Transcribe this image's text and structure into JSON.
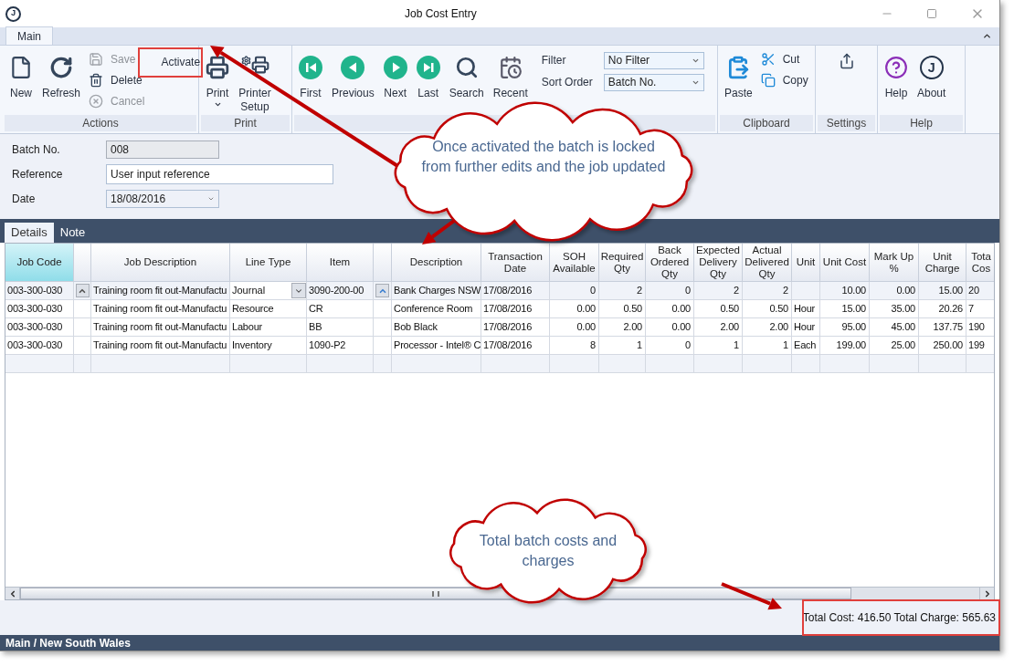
{
  "window": {
    "title": "Job Cost Entry",
    "icon_letter": "J"
  },
  "ribbon": {
    "tabs": [
      {
        "label": "Main",
        "selected": true
      }
    ],
    "groups": [
      {
        "label": "Actions",
        "buttons": [
          {
            "kind": "large",
            "label": "New",
            "disabled": false
          },
          {
            "kind": "large",
            "label": "Refresh",
            "disabled": false
          },
          {
            "kind": "small",
            "label": "Save",
            "disabled": true
          },
          {
            "kind": "small",
            "label": "Delete",
            "disabled": false
          },
          {
            "kind": "small",
            "label": "Cancel",
            "disabled": true
          },
          {
            "kind": "plain",
            "label": "Activate",
            "disabled": false
          }
        ]
      },
      {
        "label": "Print",
        "buttons": [
          {
            "kind": "large",
            "label": "Print",
            "dropdown": true,
            "disabled": false
          },
          {
            "kind": "large",
            "label": "Printer Setup",
            "disabled": false
          }
        ]
      },
      {
        "buttons": [
          {
            "kind": "large",
            "label": "First",
            "disabled": false
          },
          {
            "kind": "large",
            "label": "Previous",
            "disabled": false
          },
          {
            "kind": "large",
            "label": "Next",
            "disabled": false
          },
          {
            "kind": "large",
            "label": "Last",
            "disabled": false
          },
          {
            "kind": "large",
            "label": "Search",
            "disabled": false
          },
          {
            "kind": "large",
            "label": "Recent",
            "disabled": false
          }
        ],
        "fields": [
          {
            "label": "Filter",
            "value": "No Filter"
          },
          {
            "label": "Sort Order",
            "value": "Batch No."
          }
        ]
      },
      {
        "label": "Clipboard",
        "buttons": [
          {
            "kind": "large",
            "label": "Paste",
            "disabled": false
          },
          {
            "kind": "small",
            "label": "Cut",
            "disabled": false
          },
          {
            "kind": "small",
            "label": "Copy",
            "disabled": false
          }
        ]
      },
      {
        "label": "Settings",
        "buttons": [
          {
            "kind": "icon",
            "disabled": false
          }
        ]
      },
      {
        "label": "Help",
        "buttons": [
          {
            "kind": "large",
            "label": "Help",
            "disabled": false
          },
          {
            "kind": "large",
            "icon_letter": "J",
            "label": "About",
            "disabled": false
          }
        ]
      }
    ]
  },
  "form": {
    "fields": [
      {
        "kind": "readonly",
        "label": "Batch No.",
        "value": "008"
      },
      {
        "kind": "text",
        "label": "Reference",
        "value": "User input reference"
      },
      {
        "kind": "date",
        "label": "Date",
        "value": "18/08/2016"
      }
    ]
  },
  "detail_tabs": [
    {
      "label": "Details",
      "selected": true
    },
    {
      "label": "Note",
      "selected": false
    }
  ],
  "grid": {
    "columns": [
      {
        "kind": "text",
        "label": "Job Code",
        "selected": true
      },
      {
        "kind": "lookup",
        "selected": false
      },
      {
        "kind": "text",
        "label": "Job Description",
        "selected": false
      },
      {
        "kind": "choice",
        "label": "Line Type",
        "selected": false
      },
      {
        "kind": "text",
        "label": "Item",
        "selected": false
      },
      {
        "kind": "lookup",
        "selected": false
      },
      {
        "kind": "text",
        "label": "Description",
        "selected": false
      },
      {
        "kind": "text",
        "label": "Transaction Date",
        "selected": false
      },
      {
        "kind": "number",
        "label": "SOH Available",
        "selected": false
      },
      {
        "kind": "number",
        "label": "Required Qty",
        "selected": false
      },
      {
        "kind": "number",
        "label": "Back Ordered Qty",
        "selected": false
      },
      {
        "kind": "number",
        "label": "Expected Delivery Qty",
        "selected": false
      },
      {
        "kind": "number",
        "label": "Actual Delivered Qty",
        "selected": false
      },
      {
        "kind": "text",
        "label": "Unit",
        "selected": false
      },
      {
        "kind": "number",
        "label": "Unit Cost",
        "selected": false
      },
      {
        "kind": "number",
        "label": "Mark Up %",
        "selected": false
      },
      {
        "kind": "number",
        "label": "Unit Charge",
        "selected": false
      },
      {
        "kind": "text",
        "label": "Tota Cos",
        "selected": false
      }
    ],
    "rows": [
      {
        "current": true,
        "cells": [
          "003-300-030",
          "",
          "Training room fit out-Manufactu",
          "Journal",
          "3090-200-00",
          "",
          "Bank Charges NSW",
          "17/08/2016",
          "0",
          "2",
          "0",
          "2",
          "2",
          "",
          "10.00",
          "0.00",
          "15.00",
          "20"
        ]
      },
      {
        "current": false,
        "cells": [
          "003-300-030",
          "",
          "Training room fit out-Manufactu",
          "Resource",
          "CR",
          "",
          "Conference Room",
          "17/08/2016",
          "0.00",
          "0.50",
          "0.00",
          "0.50",
          "0.50",
          "Hour",
          "15.00",
          "35.00",
          "20.26",
          "7"
        ]
      },
      {
        "current": false,
        "cells": [
          "003-300-030",
          "",
          "Training room fit out-Manufactu",
          "Labour",
          "BB",
          "",
          "Bob Black",
          "17/08/2016",
          "0.00",
          "2.00",
          "0.00",
          "2.00",
          "2.00",
          "Hour",
          "95.00",
          "45.00",
          "137.75",
          "190"
        ]
      },
      {
        "current": false,
        "cells": [
          "003-300-030",
          "",
          "Training room fit out-Manufactu",
          "Inventory",
          "1090-P2",
          "",
          "Processor - Intel® C",
          "17/08/2016",
          "8",
          "1",
          "0",
          "1",
          "1",
          "Each",
          "199.00",
          "25.00",
          "250.00",
          "199"
        ]
      }
    ]
  },
  "totals": "Total Cost: 416.50 Total Charge: 565.63",
  "status_bar": "Main / New South Wales",
  "callouts": [
    {
      "text": "Once activated the batch is locked from further edits and the job updated"
    },
    {
      "text": "Total batch costs and charges"
    }
  ]
}
